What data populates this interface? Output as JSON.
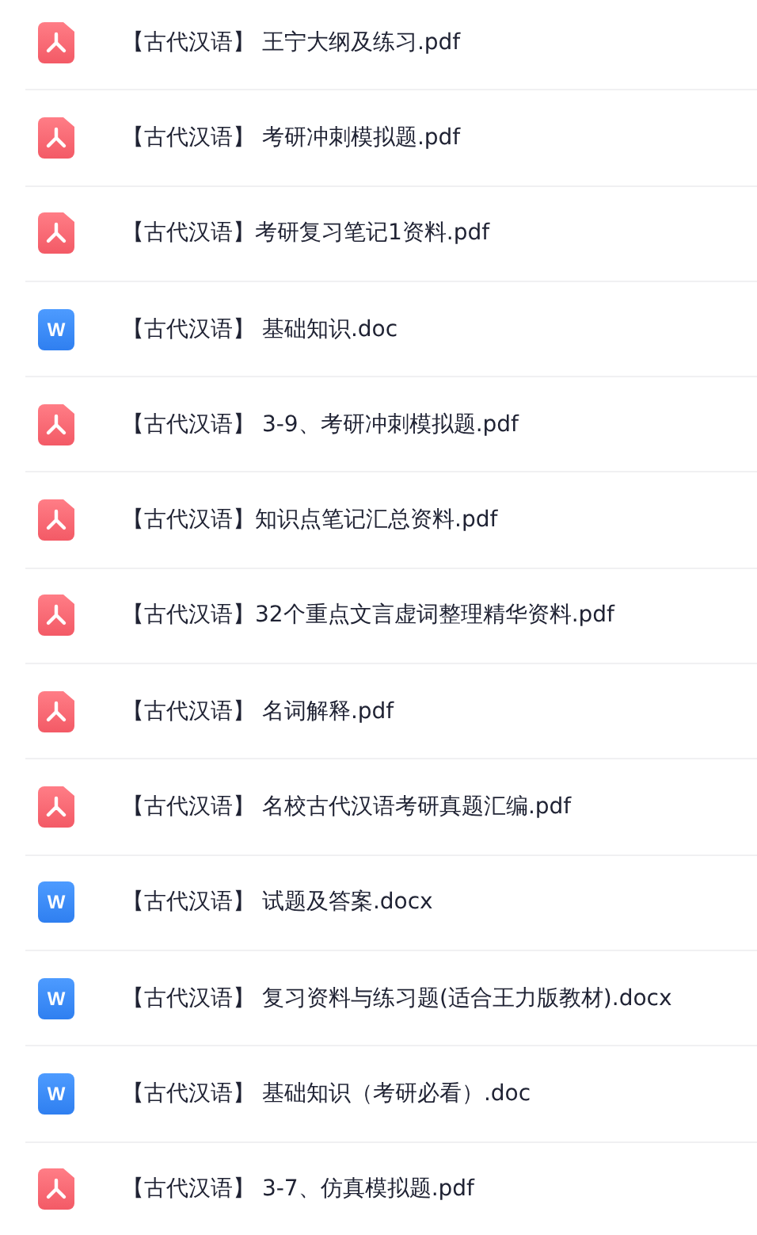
{
  "files": [
    {
      "kind": "pdf",
      "name": "【古代汉语】 王宁大纲及练习.pdf"
    },
    {
      "kind": "pdf",
      "name": "【古代汉语】 考研冲刺模拟题.pdf"
    },
    {
      "kind": "pdf",
      "name": "【古代汉语】考研复习笔记1资料.pdf"
    },
    {
      "kind": "word",
      "badge": "W",
      "name": "【古代汉语】 基础知识.doc"
    },
    {
      "kind": "pdf",
      "name": "【古代汉语】 3-9、考研冲刺模拟题.pdf"
    },
    {
      "kind": "pdf",
      "name": "【古代汉语】知识点笔记汇总资料.pdf"
    },
    {
      "kind": "pdf",
      "name": "【古代汉语】32个重点文言虚词整理精华资料.pdf"
    },
    {
      "kind": "pdf",
      "name": "【古代汉语】 名词解释.pdf"
    },
    {
      "kind": "pdf",
      "name": "【古代汉语】 名校古代汉语考研真题汇编.pdf"
    },
    {
      "kind": "word",
      "badge": "W",
      "name": "【古代汉语】 试题及答案.docx"
    },
    {
      "kind": "word",
      "badge": "W",
      "name": "【古代汉语】 复习资料与练习题(适合王力版教材).docx"
    },
    {
      "kind": "word",
      "badge": "W",
      "name": "【古代汉语】 基础知识（考研必看）.doc"
    },
    {
      "kind": "pdf",
      "name": "【古代汉语】 3-7、仿真模拟题.pdf"
    }
  ]
}
